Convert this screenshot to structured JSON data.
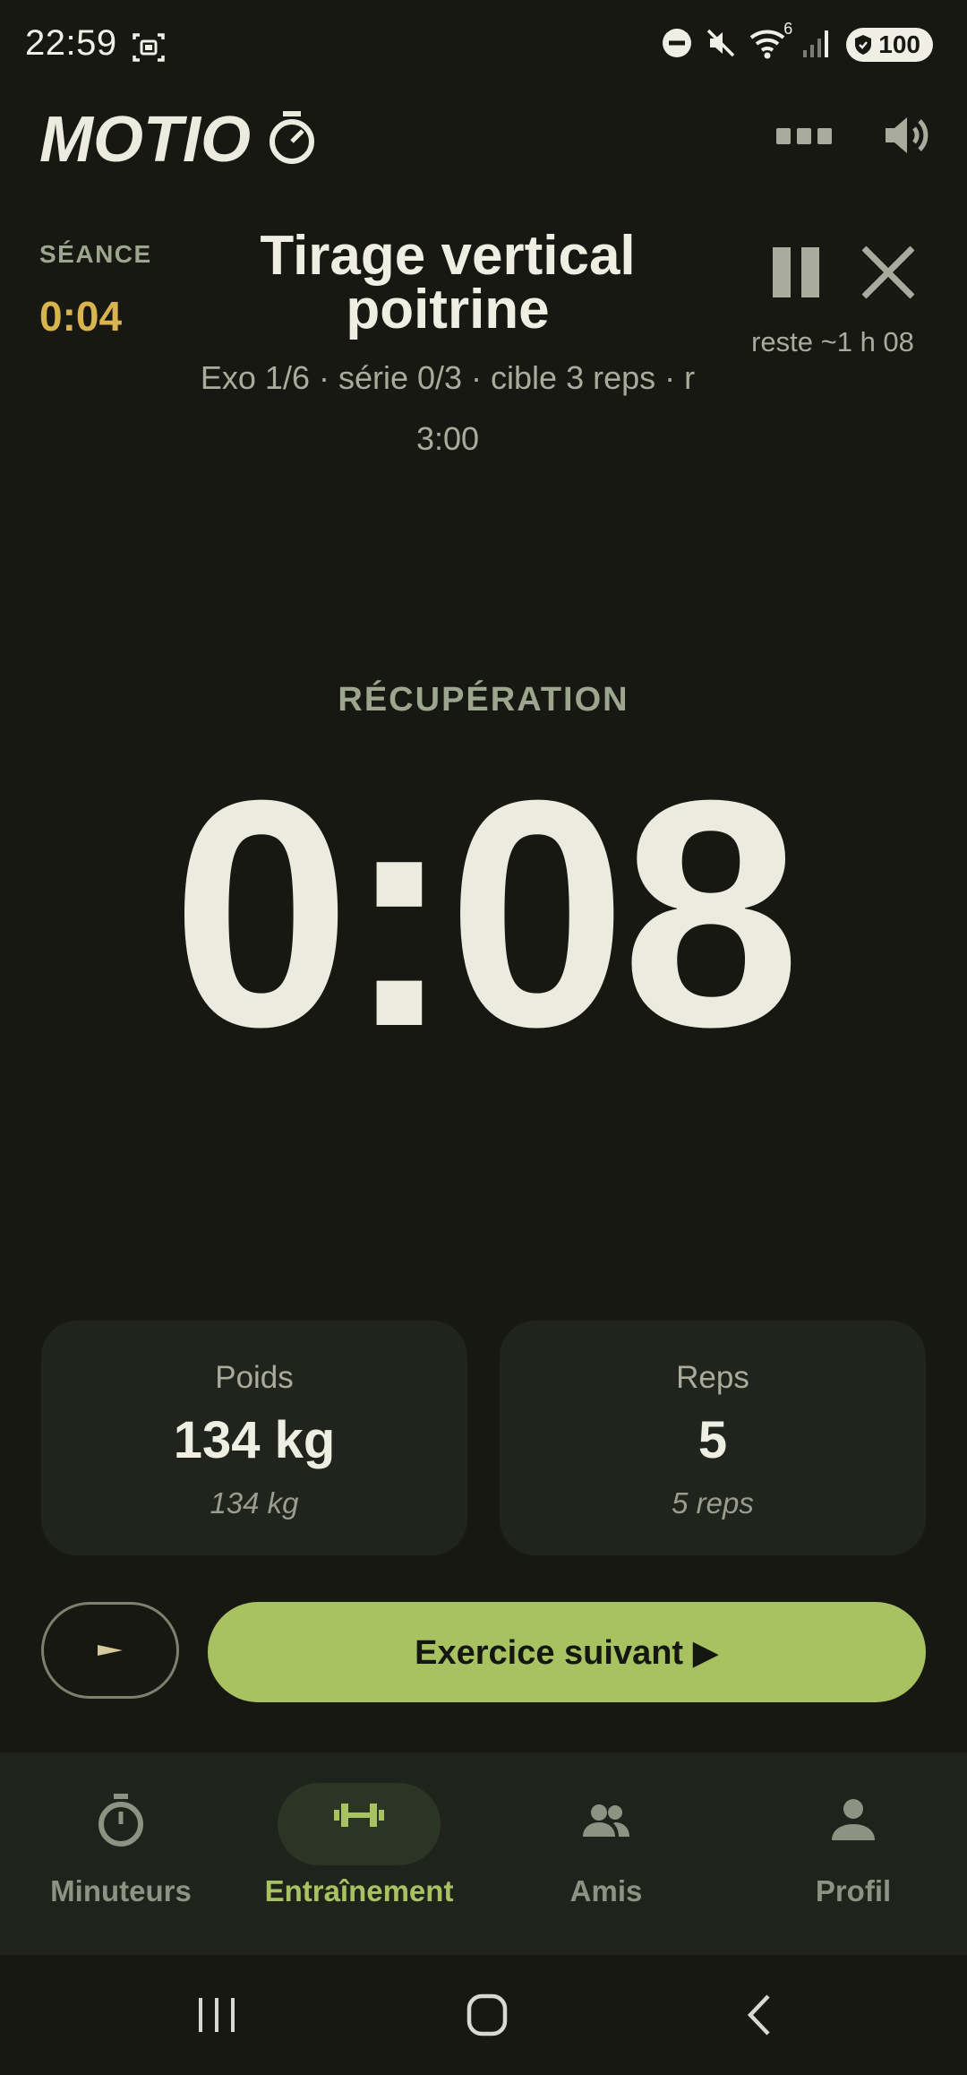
{
  "status_bar": {
    "time": "22:59",
    "wifi_badge": "6",
    "battery": "100"
  },
  "header": {
    "logo_text": "MOTIO",
    "icons": [
      "menu-dots-icon",
      "speaker-icon"
    ]
  },
  "session": {
    "seance_label": "SÉANCE",
    "seance_time": "0:04",
    "exercise_title": "Tirage vertical poitrine",
    "exercise_subtitle": "Exo 1/6 · série 0/3 · cible 3 reps · r 3:00",
    "remaining": "reste ~1 h 08",
    "controls": [
      "pause-icon",
      "close-icon"
    ]
  },
  "timer": {
    "phase": "RÉCUPÉRATION",
    "value": "0:08"
  },
  "cards": {
    "weight": {
      "label": "Poids",
      "value": "134 kg",
      "hint": "134 kg"
    },
    "reps": {
      "label": "Reps",
      "value": "5",
      "hint": "5 reps"
    }
  },
  "actions": {
    "next_label": "Exercice suivant ▶"
  },
  "bottom_nav": {
    "items": [
      {
        "label": "Minuteurs",
        "icon": "stopwatch-icon",
        "active": false
      },
      {
        "label": "Entraînement",
        "icon": "dumbbell-icon",
        "active": true
      },
      {
        "label": "Amis",
        "icon": "people-icon",
        "active": false
      },
      {
        "label": "Profil",
        "icon": "person-icon",
        "active": false
      }
    ]
  },
  "colors": {
    "background": "#161811",
    "accent": "#a8c262",
    "seance_time": "#d8b34e",
    "card": "#20241c"
  }
}
